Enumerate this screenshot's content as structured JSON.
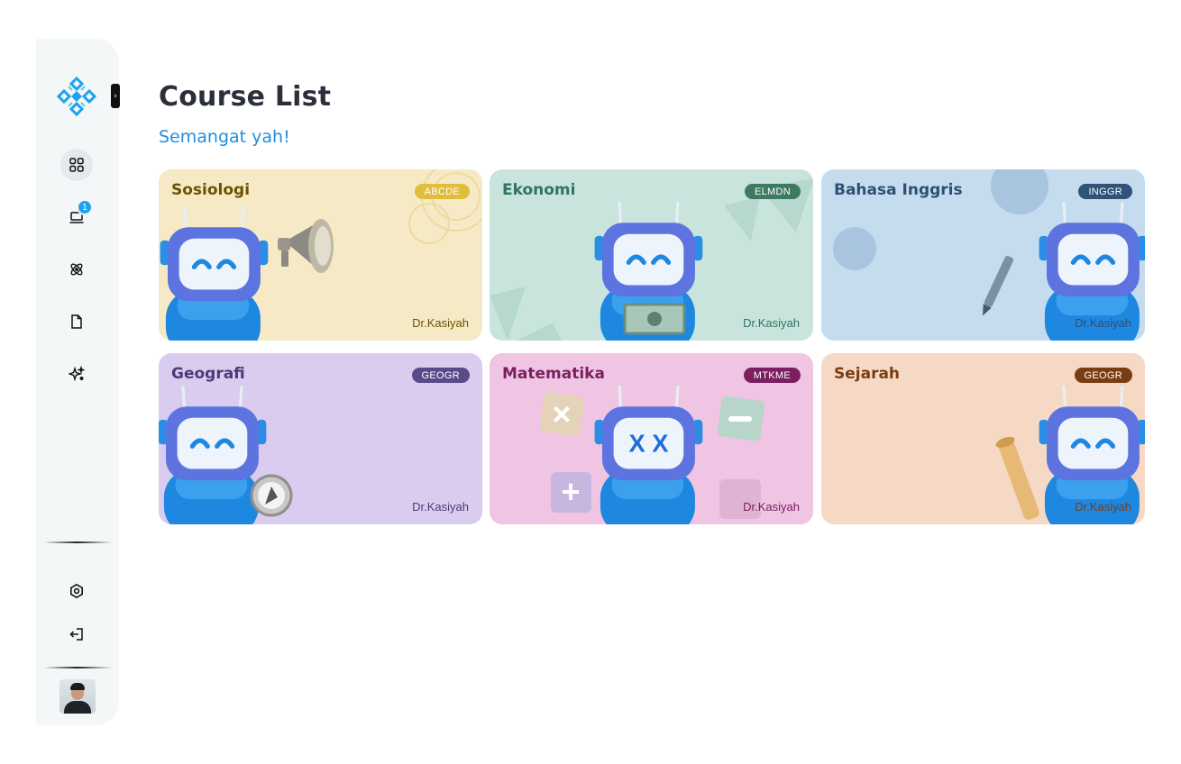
{
  "sidebar": {
    "collapse_glyph": "›",
    "nav_items": [
      {
        "name": "dashboard",
        "icon": "grid-icon",
        "active": true
      },
      {
        "name": "courses",
        "icon": "laptop-icon",
        "badge": "1"
      },
      {
        "name": "science",
        "icon": "atom-icon"
      },
      {
        "name": "documents",
        "icon": "file-icon"
      },
      {
        "name": "ai",
        "icon": "sparkles-icon"
      }
    ],
    "bottom_items": [
      {
        "name": "settings",
        "icon": "settings-icon"
      },
      {
        "name": "logout",
        "icon": "logout-icon"
      }
    ]
  },
  "page": {
    "title": "Course List",
    "subtitle": "Semangat yah!"
  },
  "courses": [
    {
      "title": "Sosiologi",
      "code": "ABCDE",
      "teacher": "Dr.Kasiyah",
      "bg": "#f6eac6",
      "title_color": "#6b5200",
      "badge_color": "#e1bd3c",
      "teacher_color": "#6b5200"
    },
    {
      "title": "Ekonomi",
      "code": "ELMDN",
      "teacher": "Dr.Kasiyah",
      "bg": "#c9e4dd",
      "title_color": "#2f7460",
      "badge_color": "#3c7a62",
      "teacher_color": "#2f7460"
    },
    {
      "title": "Bahasa Inggris",
      "code": "INGGR",
      "teacher": "Dr.Kasiyah",
      "bg": "#c5dcef",
      "title_color": "#2e4f73",
      "badge_color": "#2f5379",
      "teacher_color": "#2e4f73"
    },
    {
      "title": "Geografi",
      "code": "GEOGR",
      "teacher": "Dr.Kasiyah",
      "bg": "#d9ccee",
      "title_color": "#4d3a7a",
      "badge_color": "#5b4a8a",
      "teacher_color": "#4d3a7a"
    },
    {
      "title": "Matematika",
      "code": "MTKME",
      "teacher": "Dr.Kasiyah",
      "bg": "#efc5e3",
      "title_color": "#7b1f5f",
      "badge_color": "#7b1f5f",
      "teacher_color": "#7b1f5f"
    },
    {
      "title": "Sejarah",
      "code": "GEOGR",
      "teacher": "Dr.Kasiyah",
      "bg": "#f5d9c5",
      "title_color": "#7a3d12",
      "badge_color": "#7a3d12",
      "teacher_color": "#7a3d12"
    }
  ]
}
